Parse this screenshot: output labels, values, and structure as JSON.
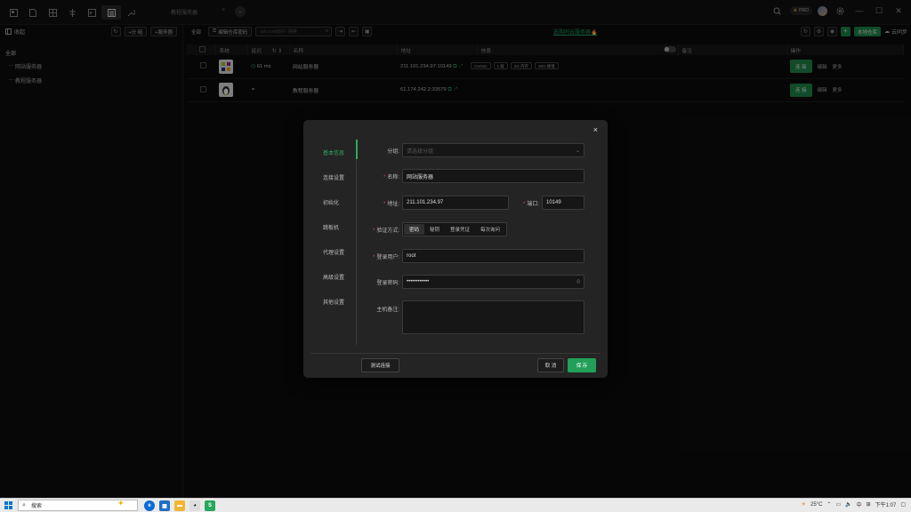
{
  "titlebar": {
    "tab_title": "教程服务器",
    "tab_close": "×",
    "tab_drop": "⌄",
    "pro_badge": "PRO",
    "window_buttons": [
      "—",
      "☐",
      "✕"
    ]
  },
  "sidebar": {
    "header_label": "收起",
    "add_group_label": "+分 组",
    "add_server_label": "+服务器",
    "tree": {
      "root": "全部",
      "children": [
        "网站服务器",
        "教程服务器"
      ]
    }
  },
  "toolbar": {
    "all_label": "全部",
    "edit_repo_label": "编辑仓库密码",
    "search_placeholder": "ssh root@IP / 搜索",
    "promo_text": "选购同云服务器🔥",
    "local_repo_label": "本地仓库",
    "cloud_sync_label": "云同步"
  },
  "table": {
    "columns": [
      "系统",
      "延迟",
      "名称",
      "地址",
      "信息",
      "备注",
      "操作"
    ],
    "rows": [
      {
        "latency": "61 ms",
        "name": "网站服务器",
        "address": "211.101.234.97:10149",
        "tags": [
          "Centos",
          "1 核",
          "2G 内存",
          "30G 硬盘"
        ],
        "connect": "连 接",
        "edit": "编辑",
        "more": "更多"
      },
      {
        "latency": "",
        "name": "教程服务器",
        "address": "61.174.242.2:33579",
        "tags": [],
        "connect": "连 接",
        "edit": "编辑",
        "more": "更多"
      }
    ]
  },
  "modal": {
    "close": "×",
    "nav": [
      "基本信息",
      "连接设置",
      "初始化",
      "跳板机",
      "代理设置",
      "高级设置",
      "其他设置"
    ],
    "form": {
      "group_label": "分组:",
      "group_placeholder": "请选择分组",
      "name_label": "名称:",
      "name_value": "网站服务器",
      "address_label": "地址:",
      "address_value": "211.101.234.97",
      "port_label": "端口:",
      "port_value": "10149",
      "auth_label": "验证方式:",
      "auth_options": [
        "密码",
        "秘钥",
        "登录凭证",
        "每次询问"
      ],
      "auth_selected": "密码",
      "user_label": "登录用户:",
      "user_value": "root",
      "password_label": "登录密码:",
      "password_value": "••••••••••••",
      "remark_label": "主机备注:",
      "remark_value": ""
    },
    "buttons": {
      "test": "测试连接",
      "cancel": "取 消",
      "save": "保 存"
    }
  },
  "taskbar": {
    "search_text": "搜索",
    "weather": "25°C",
    "ime": "中",
    "time": "下午1:07"
  },
  "colors": {
    "accent": "#22a05a",
    "required": "#e04646",
    "promo": "#23a36a"
  }
}
